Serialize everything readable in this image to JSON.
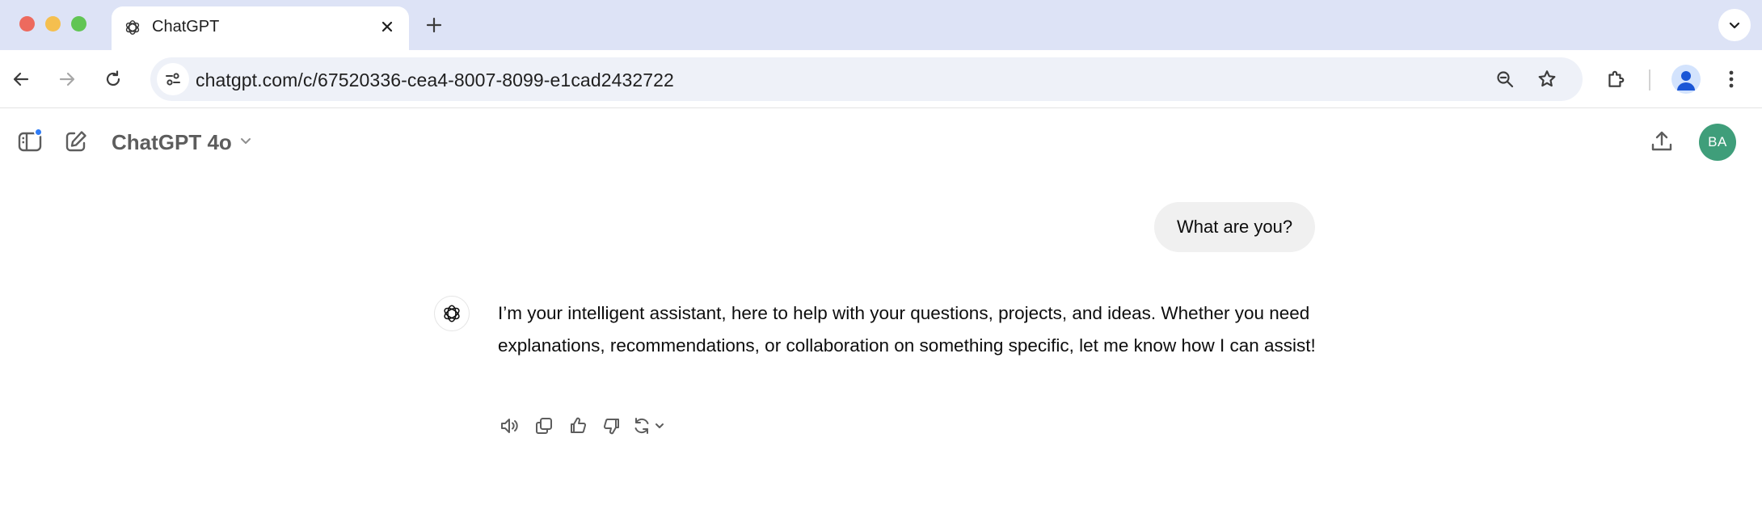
{
  "browser": {
    "tab": {
      "title": "ChatGPT"
    },
    "url": "chatgpt.com/c/67520336-cea4-8007-8099-e1cad2432722"
  },
  "app": {
    "model_name": "ChatGPT 4o",
    "avatar_initials": "BA",
    "accent_color": "#3f9e7a"
  },
  "conversation": {
    "user_message": "What are you?",
    "assistant_message": "I’m your intelligent assistant, here to help with your questions, projects, and ideas. Whether you need explanations, recommendations, or collaboration on something specific, let me know how I can assist!"
  },
  "icons": [
    "openai-logo-icon",
    "close-icon",
    "plus-icon",
    "chevron-down-icon",
    "back-icon",
    "forward-icon",
    "reload-icon",
    "site-settings-icon",
    "zoom-icon",
    "star-icon",
    "extensions-icon",
    "profile-icon",
    "kebab-menu-icon",
    "sidebar-icon",
    "new-chat-icon",
    "share-icon",
    "read-aloud-icon",
    "copy-icon",
    "thumbs-up-icon",
    "thumbs-down-icon",
    "regenerate-icon"
  ]
}
